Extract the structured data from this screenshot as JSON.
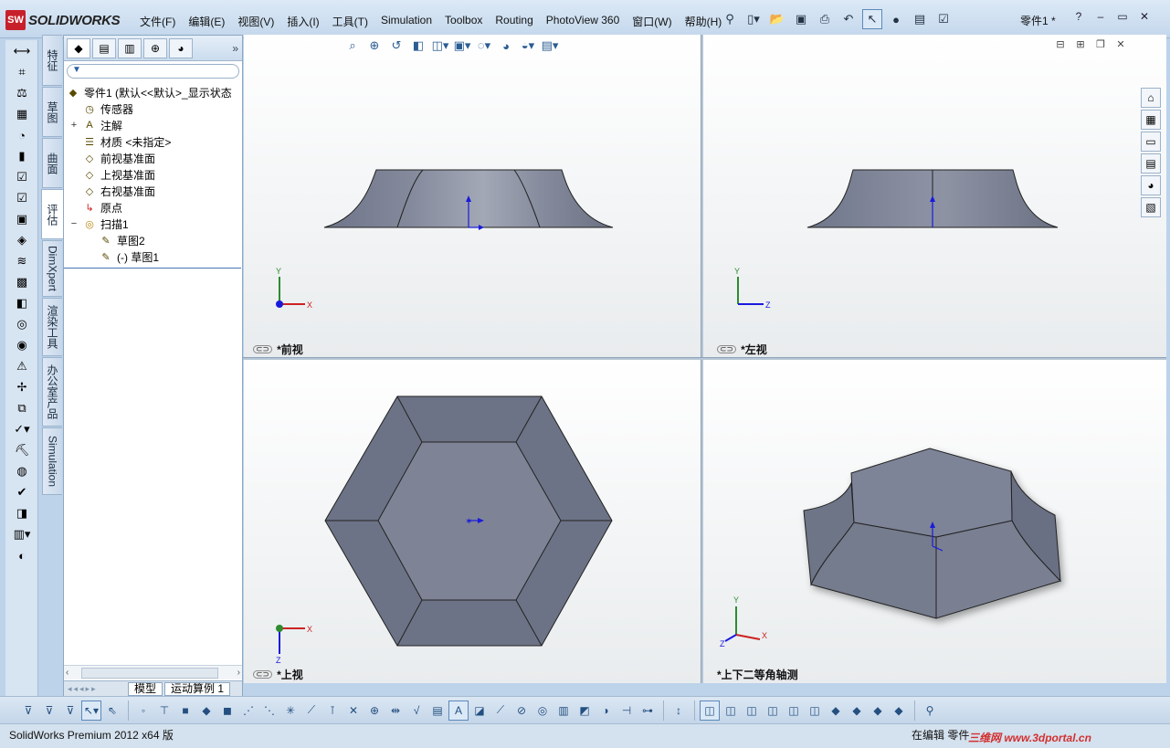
{
  "app": {
    "logo_mark": "SW",
    "logo_text": "SOLIDWORKS",
    "doc_title": "零件1 *"
  },
  "menu": [
    "文件(F)",
    "编辑(E)",
    "视图(V)",
    "插入(I)",
    "工具(T)",
    "Simulation",
    "Toolbox",
    "Routing",
    "PhotoView 360",
    "窗口(W)",
    "帮助(H)"
  ],
  "vtabs": [
    "特征",
    "草图",
    "曲面",
    "评估",
    "DimXpert",
    "渲染工具",
    "办公室产品",
    "Simulation"
  ],
  "tree": {
    "root": "零件1  (默认<<默认>_显示状态",
    "items": [
      "传感器",
      "注解",
      "材质 <未指定>",
      "前视基准面",
      "上视基准面",
      "右视基准面",
      "原点",
      "扫描1",
      "草图2",
      "(-) 草图1"
    ]
  },
  "fm_tabs": {
    "model": "模型",
    "motion": "运动算例 1"
  },
  "viewports": {
    "front": "*前视",
    "left": "*左视",
    "top": "*上视",
    "iso": "*上下二等角轴测"
  },
  "axes": {
    "x": "X",
    "y": "Y",
    "z": "Z"
  },
  "status": {
    "left": "SolidWorks Premium 2012 x64 版",
    "right": "在编辑 零件"
  },
  "watermark": "三维网 www.3dportal.cn",
  "colors": {
    "accent": "#2b5c92",
    "model": "#7f8597",
    "model_dark": "#6d7385"
  }
}
